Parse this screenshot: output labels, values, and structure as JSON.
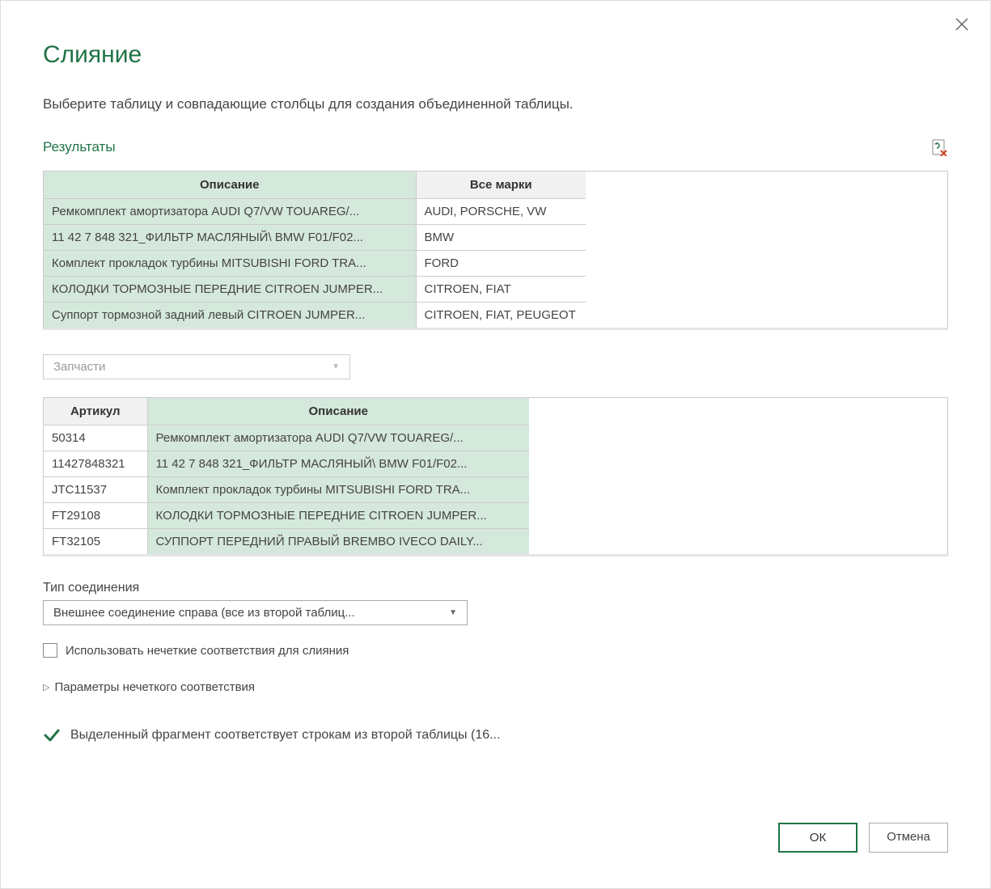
{
  "dialog": {
    "title": "Слияние",
    "subtitle": "Выберите таблицу и совпадающие столбцы для создания объединенной таблицы."
  },
  "results": {
    "label": "Результаты",
    "columns": [
      "Описание",
      "Все марки"
    ],
    "rows": [
      {
        "c0": "Ремкомплект амортизатора AUDI Q7/VW TOUAREG/...",
        "c1": "AUDI, PORSCHE, VW"
      },
      {
        "c0": "11 42 7 848 321_ФИЛЬТР МАСЛЯНЫЙ\\ BMW F01/F02...",
        "c1": "BMW"
      },
      {
        "c0": "Комплект прокладок турбины MITSUBISHI FORD TRA...",
        "c1": "FORD"
      },
      {
        "c0": "КОЛОДКИ ТОРМОЗНЫЕ ПЕРЕДНИЕ CITROEN JUMPER...",
        "c1": "CITROEN, FIAT"
      },
      {
        "c0": "Суппорт тормозной задний левый CITROEN JUMPER...",
        "c1": "CITROEN, FIAT, PEUGEOT"
      }
    ]
  },
  "secondTable": {
    "dropdown": "Запчасти",
    "columns": [
      "Артикул",
      "Описание"
    ],
    "rows": [
      {
        "c0": "50314",
        "c1": "Ремкомплект амортизатора AUDI Q7/VW TOUAREG/..."
      },
      {
        "c0": "11427848321",
        "c1": "11 42 7 848 321_ФИЛЬТР МАСЛЯНЫЙ\\ BMW F01/F02..."
      },
      {
        "c0": "JTC11537",
        "c1": "Комплект прокладок турбины MITSUBISHI FORD TRA..."
      },
      {
        "c0": "FT29108",
        "c1": "КОЛОДКИ ТОРМОЗНЫЕ ПЕРЕДНИЕ CITROEN JUMPER..."
      },
      {
        "c0": "FT32105",
        "c1": "СУППОРТ ПЕРЕДНИЙ ПРАВЫЙ BREMBO IVECO DAILY..."
      }
    ]
  },
  "joinType": {
    "label": "Тип соединения",
    "value": "Внешнее соединение справа (все из второй таблиц..."
  },
  "fuzzy": {
    "checkbox_label": "Использовать нечеткие соответствия для слияния",
    "expand_label": "Параметры нечеткого соответствия"
  },
  "status": {
    "text": "Выделенный фрагмент соответствует строкам из второй таблицы (16..."
  },
  "buttons": {
    "ok": "ОК",
    "cancel": "Отмена"
  }
}
